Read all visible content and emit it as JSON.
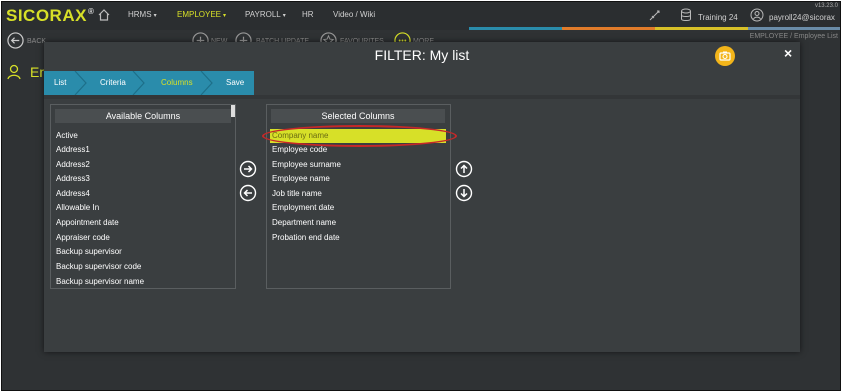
{
  "app": {
    "logo": "SICORAX",
    "logo_mark": "®",
    "version": "v13.23.0",
    "nav": [
      {
        "label": "HRMS",
        "caret": "▾"
      },
      {
        "label": "EMPLOYEE",
        "caret": "▾"
      },
      {
        "label": "PAYROLL",
        "caret": "▾"
      },
      {
        "label": "HR",
        "caret": ""
      },
      {
        "label": "Video / Wiki",
        "caret": ""
      }
    ],
    "training_label": "Training 24",
    "user_label": "payroll24@sicorax",
    "breadcrumb": "EMPLOYEE /  Employee List",
    "toolbar_fragments": [
      "BACK",
      "NEW",
      "BATCH UPDATE",
      "FAVOURITES",
      "MORE"
    ],
    "page_title_fragment": "Em",
    "accent_colors": {
      "brand": "#d7e028",
      "wizard": "#2a8cab",
      "camera": "#f3b51a",
      "ring": "#c62828"
    }
  },
  "modal": {
    "title": "FILTER: My list",
    "close_label": "×",
    "steps": [
      {
        "label": "List"
      },
      {
        "label": "Criteria"
      },
      {
        "label": "Columns",
        "active": true
      },
      {
        "label": "Save"
      }
    ],
    "available": {
      "header": "Available Columns",
      "items": [
        "Active",
        "Address1",
        "Address2",
        "Address3",
        "Address4",
        "Allowable In",
        "Appointment date",
        "Appraiser code",
        "Backup supervisor",
        "Backup supervisor code",
        "Backup supervisor name"
      ]
    },
    "selected": {
      "header": "Selected Columns",
      "selected_item": "Company name",
      "items": [
        "Company name",
        "Employee code",
        "Employee surname",
        "Employee name",
        "Job title name",
        "Employment date",
        "Department name",
        "Probation end date"
      ]
    }
  }
}
